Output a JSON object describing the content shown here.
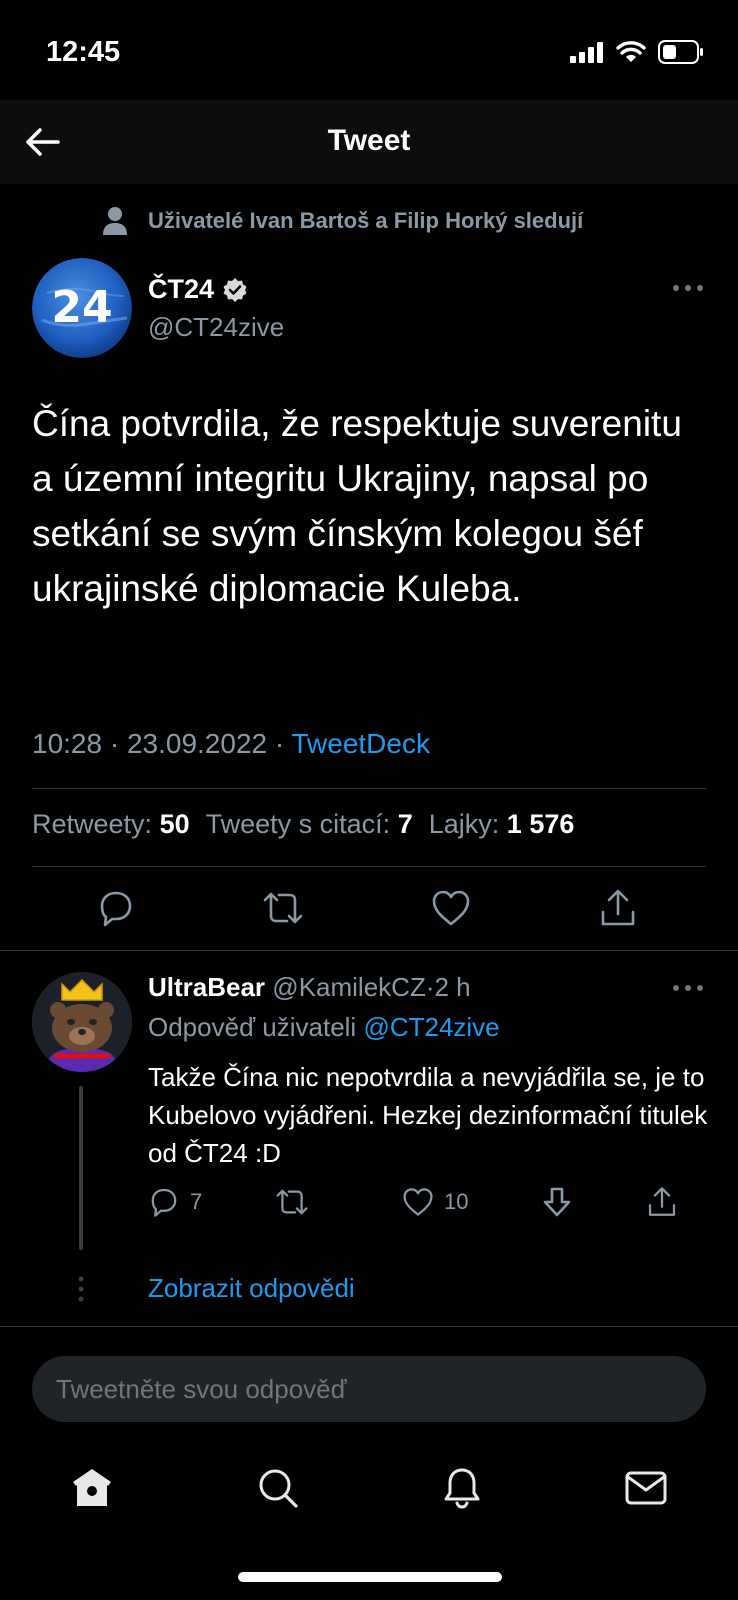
{
  "status": {
    "time": "12:45"
  },
  "nav": {
    "title": "Tweet"
  },
  "social_context": "Uživatelé Ivan Bartoš a Filip Horký sledují",
  "author": {
    "name": "ČT24",
    "handle": "@CT24zive",
    "avatar_text": "24",
    "verified": true
  },
  "tweet": {
    "text": "Čína potvrdila, že respektuje suverenitu a územní integritu Ukrajiny, napsal po setkání se svým čínským kolegou šéf ukrajinské diplomacie Kuleba.",
    "time": "10:28 · 23.09.2022 · ",
    "source": "TweetDeck",
    "retweets_label": "Retweety:",
    "retweets": "50",
    "quotes_label": "Tweety s citací:",
    "quotes": "7",
    "likes_label": "Lajky:",
    "likes": "1 576"
  },
  "reply": {
    "name": "UltraBear",
    "handle": "@KamilekCZ",
    "sep": "·",
    "age": "2 h",
    "reply_to_label": "Odpověď uživateli",
    "reply_to": "@CT24zive",
    "text": "Takže Čína nic nepotvrdila a nevyjádřila se, je to Kubelovo vyjádřeni. Hezkej dezinformační titulek od ČT24 :D",
    "replies": "7",
    "likes": "10"
  },
  "show_replies": "Zobrazit odpovědi",
  "reply_input": {
    "placeholder": "Tweetněte svou odpověď"
  },
  "colors": {
    "accent": "#1d9bf0",
    "background": "#000000",
    "secondary_text": "#8b98a5"
  },
  "icons": [
    "back-arrow-icon",
    "person-icon",
    "verified-icon",
    "more-icon",
    "reply-icon",
    "retweet-icon",
    "like-icon",
    "share-icon",
    "downvote-icon",
    "home-icon",
    "search-icon",
    "notifications-icon",
    "messages-icon"
  ]
}
